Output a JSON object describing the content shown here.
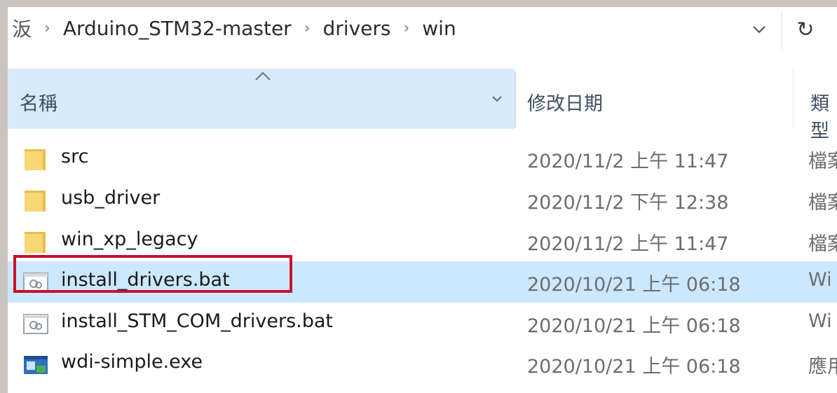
{
  "address_bar": {
    "crumbs": [
      "汳",
      "Arduino_STM32-master",
      "drivers",
      "win"
    ]
  },
  "columns": {
    "name": "名稱",
    "date": "修改日期",
    "type": "類型"
  },
  "files": [
    {
      "name": "src",
      "date": "2020/11/2 上午 11:47",
      "type": "檔案",
      "icon": "folder-icon"
    },
    {
      "name": "usb_driver",
      "date": "2020/11/2 下午 12:38",
      "type": "檔案",
      "icon": "folder-icon"
    },
    {
      "name": "win_xp_legacy",
      "date": "2020/11/2 上午 11:47",
      "type": "檔案",
      "icon": "folder-icon"
    },
    {
      "name": "install_drivers.bat",
      "date": "2020/10/21 上午 06:18",
      "type": "Wi",
      "icon": "batch-file-icon",
      "selected": true
    },
    {
      "name": "install_STM_COM_drivers.bat",
      "date": "2020/10/21 上午 06:18",
      "type": "Wi",
      "icon": "batch-file-icon"
    },
    {
      "name": "wdi-simple.exe",
      "date": "2020/10/21 上午 06:18",
      "type": "應用",
      "icon": "exe-file-icon"
    }
  ],
  "colors": {
    "header_bg": "#d9ebf9",
    "selected_bg": "#cce8ff",
    "highlight_border": "#c8102e",
    "folder_yellow": "#f8d775"
  }
}
